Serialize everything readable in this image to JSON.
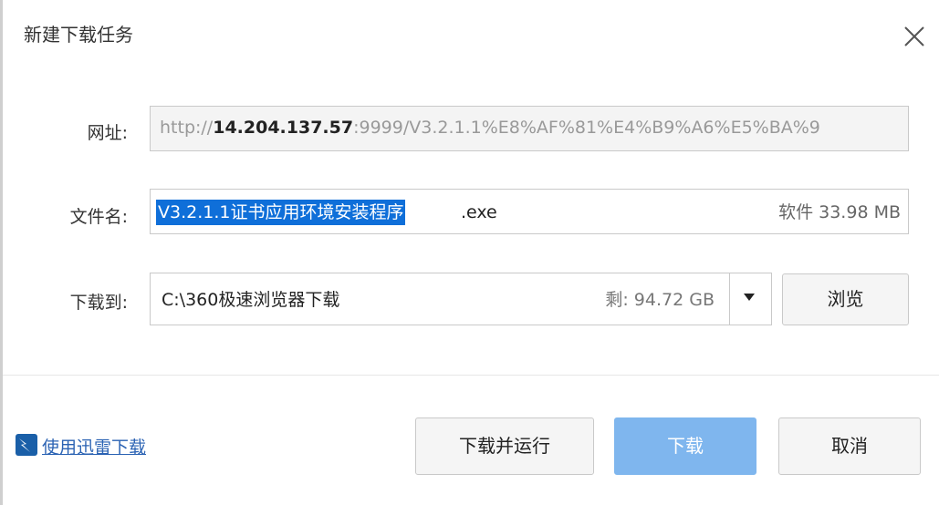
{
  "dialog": {
    "title": "新建下载任务"
  },
  "url": {
    "label": "网址:",
    "prefix": "http://",
    "host": "14.204.137.57",
    "rest": ":9999/V3.2.1.1%E8%AF%81%E4%B9%A6%E5%BA%9"
  },
  "filename": {
    "label": "文件名:",
    "selected": "V3.2.1.1证书应用环境安装程序",
    "ext": ".exe",
    "meta": "软件 33.98 MB"
  },
  "save": {
    "label": "下载到:",
    "path": "C:\\360极速浏览器下载",
    "free": "剩: 94.72 GB",
    "browse_label": "浏览"
  },
  "footer": {
    "xunlei_link": "使用迅雷下载",
    "download_run_label": "下载并运行",
    "download_label": "下载",
    "cancel_label": "取消"
  },
  "colors": {
    "selection": "#0f6fd9",
    "primary_button": "#7fb6ee",
    "link": "#2a62b3"
  },
  "icons": {
    "close": "close-icon",
    "dropdown": "chevron-down-icon",
    "xunlei": "xunlei-logo-icon"
  }
}
